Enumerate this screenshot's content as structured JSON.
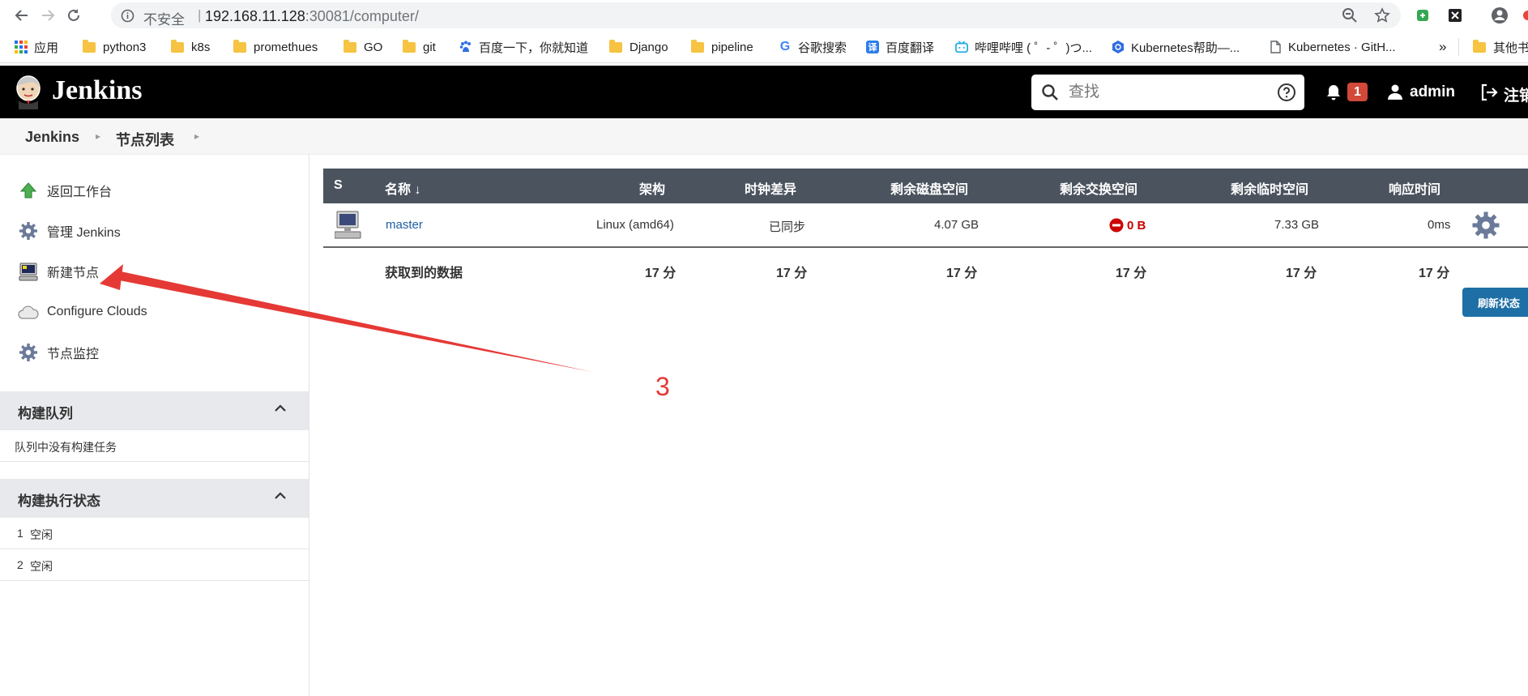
{
  "browser": {
    "url_security": "不安全",
    "url_separator": "|",
    "url_host": "192.168.11.128",
    "url_port_path": ":30081/computer/",
    "bookmarks": [
      {
        "label": "应用",
        "icon": "apps-grid-icon"
      },
      {
        "label": "python3",
        "icon": "folder-icon"
      },
      {
        "label": "k8s",
        "icon": "folder-icon"
      },
      {
        "label": "promethues",
        "icon": "folder-icon"
      },
      {
        "label": "GO",
        "icon": "folder-icon"
      },
      {
        "label": "git",
        "icon": "folder-icon"
      },
      {
        "label": "百度一下，你就知道",
        "icon": "baidu-icon"
      },
      {
        "label": "Django",
        "icon": "folder-icon"
      },
      {
        "label": "pipeline",
        "icon": "folder-icon"
      },
      {
        "label": "谷歌搜索",
        "icon": "google-icon"
      },
      {
        "label": "百度翻译",
        "icon": "translate-icon"
      },
      {
        "label": "哔哩哔哩 ( ゜- ゜)つ...",
        "icon": "bilibili-icon"
      },
      {
        "label": "Kubernetes帮助—...",
        "icon": "kubernetes-icon"
      },
      {
        "label": "Kubernetes · GitH...",
        "icon": "page-icon"
      },
      {
        "label": "»",
        "icon": "more-icon"
      },
      {
        "label": "其他书",
        "icon": "folder-icon"
      }
    ]
  },
  "header": {
    "title": "Jenkins",
    "search_placeholder": "查找",
    "notification_count": "1",
    "user": "admin",
    "logout": "注销"
  },
  "breadcrumb": [
    "Jenkins",
    "节点列表"
  ],
  "tasks": [
    {
      "label": "返回工作台",
      "icon": "up-arrow-icon"
    },
    {
      "label": "管理 Jenkins",
      "icon": "gear-icon"
    },
    {
      "label": "新建节点",
      "icon": "computer-icon"
    },
    {
      "label": "Configure Clouds",
      "icon": "cloud-icon"
    },
    {
      "label": "节点监控",
      "icon": "gear-icon"
    }
  ],
  "build_queue": {
    "title": "构建队列",
    "empty_text": "队列中没有构建任务"
  },
  "executors": {
    "title": "构建执行状态",
    "rows": [
      {
        "num": "1",
        "status": "空闲"
      },
      {
        "num": "2",
        "status": "空闲"
      }
    ]
  },
  "table": {
    "headers": [
      "S",
      "名称 ↓",
      "架构",
      "时钟差异",
      "剩余磁盘空间",
      "剩余交换空间",
      "剩余临时空间",
      "响应时间"
    ],
    "master": {
      "name": "master",
      "arch": "Linux (amd64)",
      "clock": "已同步",
      "disk": "4.07 GB",
      "swap": "0 B",
      "temp": "7.33 GB",
      "response": "0ms"
    },
    "totals": {
      "label": "获取到的数据",
      "values": [
        "17 分",
        "17 分",
        "17 分",
        "17 分",
        "17 分",
        "17 分"
      ]
    },
    "refresh_button": "刷新状态"
  },
  "annotation": {
    "label": "3",
    "color": "#e53935"
  }
}
